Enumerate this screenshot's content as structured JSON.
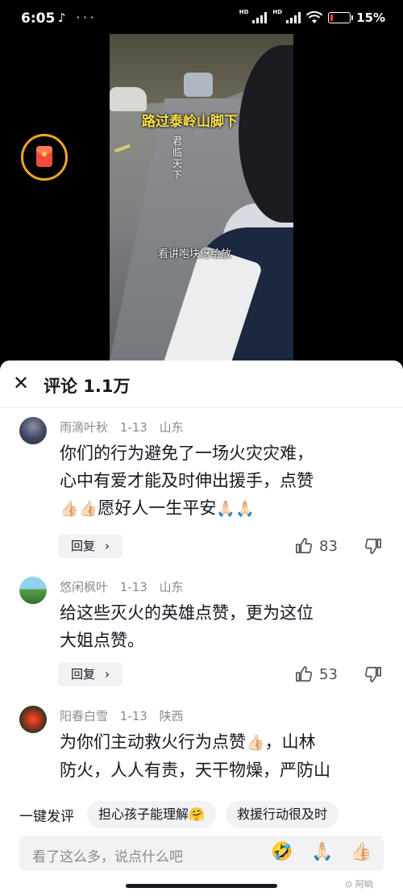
{
  "status_bar": {
    "time": "6:05",
    "app_icons": "♪ ···",
    "sig_label": "HD",
    "battery_percent": "15%",
    "battery_level": 0.15
  },
  "video": {
    "title_overlay": "路过泰岭山脚下",
    "vertical_text": "君临天下",
    "subtitle": "看讲咆块伢给放"
  },
  "comments_panel": {
    "title": "评论 1.1万",
    "comments": [
      {
        "author": "雨滴叶秋",
        "date": "1-13",
        "location": "山东",
        "text_line1": "你们的行为避免了一场火灾灾难，",
        "text_line2": "心中有爱才能及时伸出援手，点赞",
        "text_line3": "愿好人一生平安",
        "reply_label": "回复",
        "likes": "83"
      },
      {
        "author": "悠闲枫叶",
        "date": "1-13",
        "location": "山东",
        "text_line1": "给这些灭火的英雄点赞，更为这位",
        "text_line2": "大姐点赞。",
        "reply_label": "回复",
        "likes": "53"
      },
      {
        "author": "阳春白雪",
        "date": "1-13",
        "location": "陕西",
        "text_line1": "为你们主动救火行为点赞",
        "text_line1b": "，山林",
        "text_line2": "防火，人人有责，天干物燥，严防山"
      }
    ]
  },
  "quick_reply": {
    "lead": "一键发评",
    "chips": [
      "担心孩子能理解🤗",
      "救援行动很及时"
    ]
  },
  "input": {
    "placeholder": "看了这么多，说点什么吧"
  },
  "watermark": "⊙ 阿晌",
  "icons": {
    "close": "close-icon",
    "like": "thumbs-up-icon",
    "dislike": "thumbs-down-icon",
    "packet": "red-packet-icon"
  },
  "colors": {
    "title_overlay": "#ffe14a",
    "packet_ring": "#f5a623",
    "meta_gray": "#8a8b91"
  }
}
